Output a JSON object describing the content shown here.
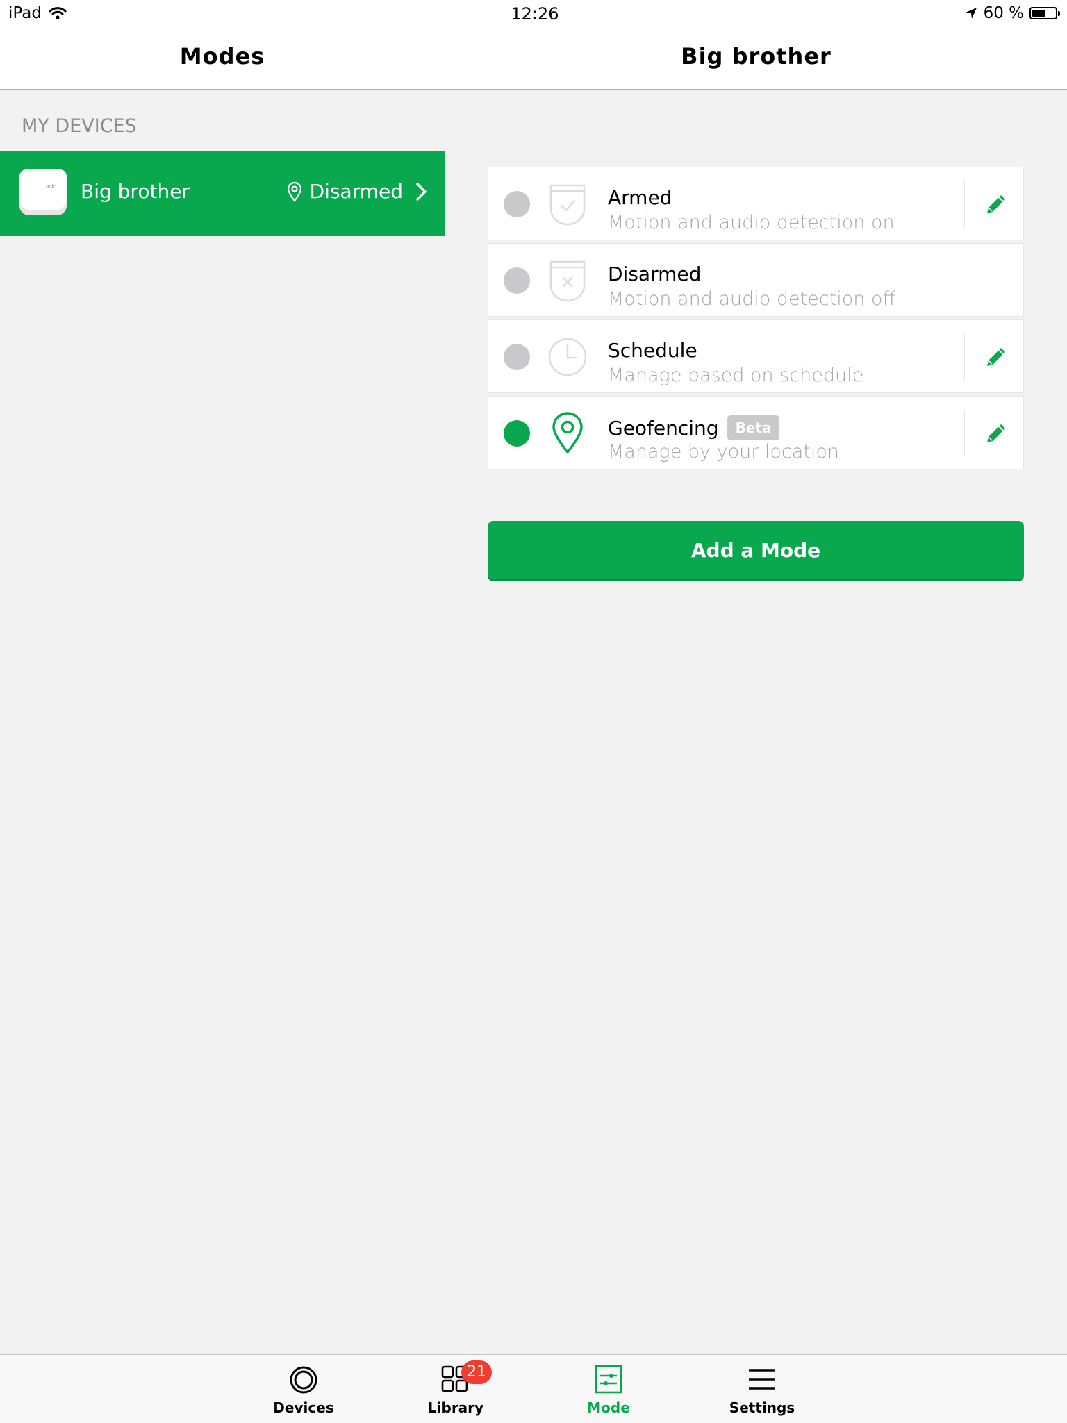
{
  "status_bar": {
    "device": "iPad",
    "time": "12:26",
    "battery_text": "60 %",
    "battery_level": 0.6
  },
  "master": {
    "title": "Modes",
    "section_header": "MY DEVICES",
    "device": {
      "thumb_text": "arlo",
      "name": "Big brother",
      "status": "Disarmed"
    }
  },
  "detail": {
    "title": "Big brother",
    "modes": [
      {
        "name": "Armed",
        "description": "Motion and audio detection on",
        "icon": "shield-check-icon",
        "selected": false,
        "editable": true
      },
      {
        "name": "Disarmed",
        "description": "Motion and audio detection off",
        "icon": "shield-x-icon",
        "selected": false,
        "editable": false
      },
      {
        "name": "Schedule",
        "description": "Manage based on schedule",
        "icon": "clock-icon",
        "selected": false,
        "editable": true
      },
      {
        "name": "Geofencing",
        "badge": "Beta",
        "description": "Manage by your location",
        "icon": "location-pin-icon",
        "selected": true,
        "editable": true
      }
    ],
    "add_mode_label": "Add a Mode"
  },
  "tabbar": {
    "tabs": [
      {
        "label": "Devices",
        "icon": "camera-lens-icon",
        "active": false
      },
      {
        "label": "Library",
        "icon": "grid-icon",
        "active": false,
        "badge": "21"
      },
      {
        "label": "Mode",
        "icon": "sliders-icon",
        "active": true
      },
      {
        "label": "Settings",
        "icon": "menu-icon",
        "active": false
      }
    ]
  },
  "colors": {
    "accent": "#0aa84e",
    "inactive_radio": "#c9c9cc",
    "badge_red": "#f23c2f",
    "subtitle_gray": "#a7a7a7"
  }
}
